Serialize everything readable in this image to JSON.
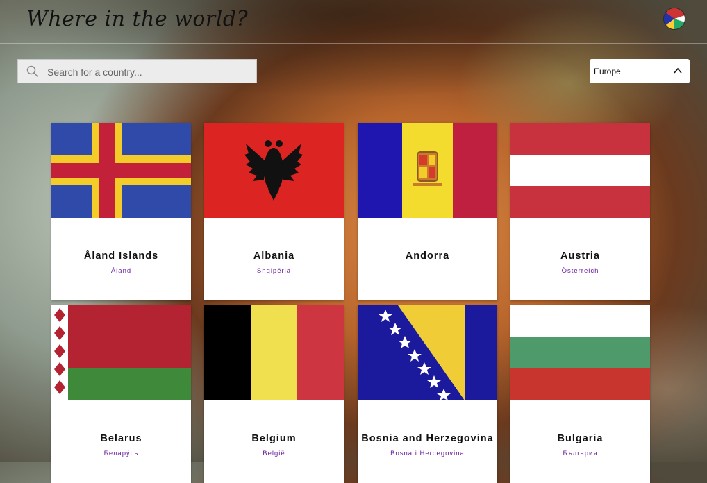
{
  "app": {
    "title": "Where in the world?"
  },
  "search": {
    "placeholder": "Search for a country..."
  },
  "region_filter": {
    "selected": "Europe"
  },
  "countries": [
    {
      "name": "Åland Islands",
      "native": "Åland"
    },
    {
      "name": "Albania",
      "native": "Shqipëria"
    },
    {
      "name": "Andorra",
      "native": ""
    },
    {
      "name": "Austria",
      "native": "Österreich"
    },
    {
      "name": "Belarus",
      "native": "Белару́сь"
    },
    {
      "name": "Belgium",
      "native": "België"
    },
    {
      "name": "Bosnia and Herzegovina",
      "native": "Bosna i Hercegovina"
    },
    {
      "name": "Bulgaria",
      "native": "България"
    }
  ],
  "colors": {
    "native_text": "#6a1f9e",
    "card_bg": "#ffffff"
  }
}
